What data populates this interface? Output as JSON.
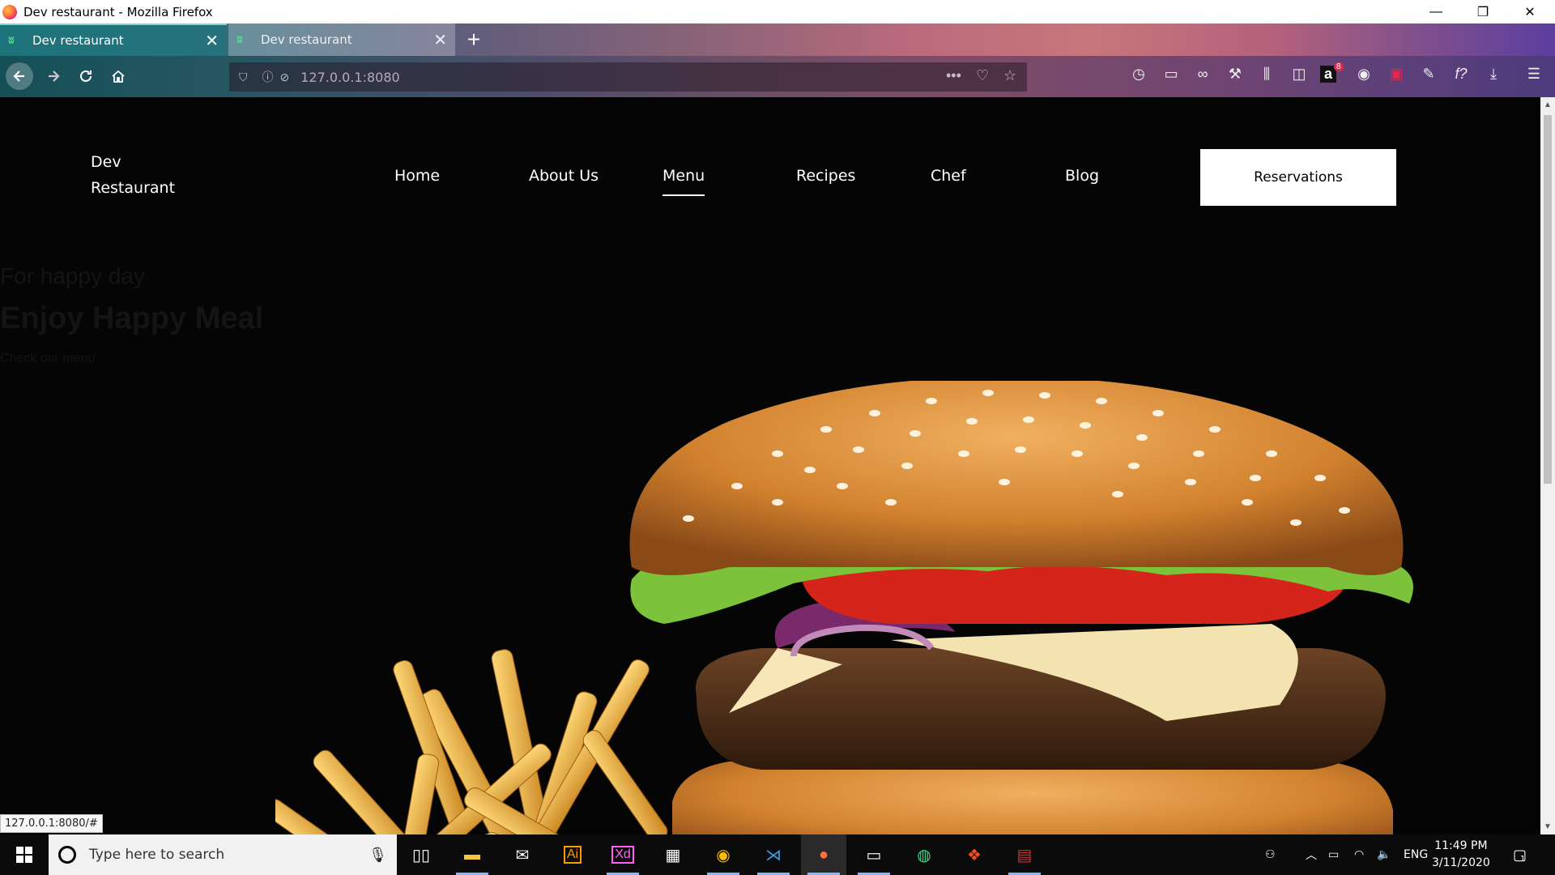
{
  "window": {
    "title": "Dev restaurant - Mozilla Firefox",
    "minimize_glyph": "—",
    "restore_glyph": "❐",
    "close_glyph": "✕"
  },
  "tabs": [
    {
      "label": "Dev restaurant",
      "active": true
    },
    {
      "label": "Dev restaurant",
      "active": false
    }
  ],
  "tab_close_glyph": "✕",
  "new_tab_glyph": "+",
  "toolbar": {
    "url": "127.0.0.1:8080",
    "notification_badge": "8",
    "icons": [
      "back-icon",
      "forward-icon",
      "reload-icon",
      "home-icon",
      "shield-icon",
      "info-icon",
      "permissions-icon",
      "more-icon",
      "pocket-icon",
      "bookmark-star-icon",
      "history-icon",
      "downloads-folder-icon",
      "mask-icon",
      "wrench-icon",
      "library-icon",
      "sidebar-icon",
      "amazon-icon",
      "account-icon",
      "pocket-red-icon",
      "pen-icon",
      "function-icon",
      "download-icon",
      "hamburger-menu-icon"
    ]
  },
  "site": {
    "brand_line1": "Dev",
    "brand_line2": "Restaurant",
    "nav": [
      {
        "label": "Home",
        "active": false
      },
      {
        "label": "About Us",
        "active": false
      },
      {
        "label": "Menu",
        "active": true
      },
      {
        "label": "Recipes",
        "active": false
      },
      {
        "label": "Chef",
        "active": false
      },
      {
        "label": "Blog",
        "active": false
      }
    ],
    "cta": "Reservations",
    "hero_subtitle": "For happy day",
    "hero_title": "Enjoy Happy Meal",
    "hero_link": "Check our menu"
  },
  "status_tooltip": "127.0.0.1:8080/#",
  "taskbar": {
    "search_placeholder": "Type here to search",
    "apps": [
      "task-view-icon",
      "file-explorer-icon",
      "mail-icon",
      "illustrator-icon",
      "xd-icon",
      "calculator-icon",
      "chrome-icon",
      "vscode-icon",
      "firefox-icon",
      "terminal-icon",
      "android-studio-icon",
      "figma-icon",
      "winrar-icon"
    ],
    "app_glyphs": {
      "illustrator": "Ai",
      "xd": "Xd"
    },
    "language": "ENG",
    "time": "11:49 PM",
    "date": "3/11/2020",
    "notifications": "1"
  },
  "colors": {
    "page_bg": "#050505",
    "cta_bg": "#ffffff",
    "bun": "#d98a3a",
    "tomato": "#d5241a",
    "lettuce": "#7cc23a",
    "cheese": "#f3e3b0",
    "patty": "#5a3820",
    "fries": "#f2b23a"
  }
}
